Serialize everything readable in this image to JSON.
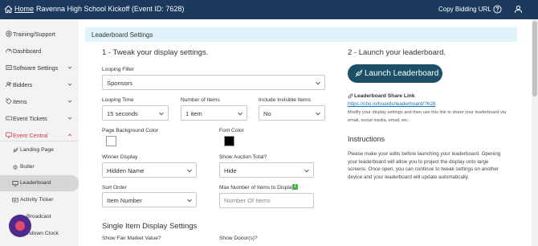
{
  "topbar": {
    "home_label": "Home",
    "event_title": "Ravenna High School Kickoff (Event ID: 7628)",
    "copy_url_label": "Copy Bidding URL"
  },
  "sidebar": {
    "items": [
      {
        "label": "Training/Support",
        "icon": "help-icon"
      },
      {
        "label": "Dashboard",
        "icon": "dashboard-icon"
      },
      {
        "label": "Software Settings",
        "icon": "settings-icon"
      },
      {
        "label": "Bidders",
        "icon": "users-icon"
      },
      {
        "label": "Items",
        "icon": "tag-icon"
      },
      {
        "label": "Event Tickets",
        "icon": "ticket-icon"
      },
      {
        "label": "Event Central",
        "icon": "monitor-icon"
      }
    ],
    "sub_items": [
      {
        "label": "Landing Page",
        "icon": "rocket-icon"
      },
      {
        "label": "Butler",
        "icon": "gear-icon"
      },
      {
        "label": "Leaderboard",
        "icon": "leaderboard-icon"
      },
      {
        "label": "Activity Ticker",
        "icon": "ticker-icon"
      },
      {
        "label": "Broadcast",
        "icon": "broadcast-icon"
      },
      {
        "label": "ndown Clock",
        "icon": "clock-icon"
      }
    ],
    "active_item": "Leaderboard",
    "accent_color": "#d9344a"
  },
  "panel": {
    "title": "Leaderboard Settings",
    "step1_heading": "1 - Tweak your display settings.",
    "step2_heading": "2 - Launch your leaderboard.",
    "looping_filter": {
      "label": "Looping Filter",
      "value": "Sponsors"
    },
    "looping_time": {
      "label": "Looping Time",
      "value": "15 seconds"
    },
    "number_of_items": {
      "label": "Number of Items",
      "value": "1 item"
    },
    "include_invisible": {
      "label": "Include Invisible Items",
      "value": "No"
    },
    "bg_color": {
      "label": "Page Background Color",
      "value": "#ffffff"
    },
    "font_color": {
      "label": "Font Color",
      "value": "#000000"
    },
    "winner_display": {
      "label": "Winner Display",
      "value": "Hidden Name"
    },
    "show_auction_total": {
      "label": "Show Auction Total?",
      "value": "Hide"
    },
    "sort_order": {
      "label": "Sort Order",
      "value": "Item Number"
    },
    "max_items": {
      "label": "Max Number of Items to Display",
      "placeholder": "Number Of Items"
    },
    "single_item_heading": "Single Item Display Settings",
    "show_fmv_label": "Show Fair Market Value?",
    "show_donors_label": "Show Donor(s)?",
    "launch_button": "Launch Leaderboard",
    "share_link_title": "Leaderboard Share Link",
    "share_link_url": "https://cbo.io/boards/leaderboard/?628",
    "share_note_1": "Modify your display settings and then use this link to share your leaderboard via",
    "share_note_2": "email, social media, email, etc.",
    "instructions_heading": "Instructions",
    "instructions_lines": [
      "Please make your edits before launching your leaderboard. Opening",
      "your leaderboard will allow you to project the display onto large",
      "screens. Once open, you can continue to tweak settings on another",
      "device and your leaderboard will update automatically."
    ]
  },
  "colors": {
    "topbar": "#1b3a5c",
    "panel_header": "#dff3fb",
    "launch_button": "#1d4f68",
    "link": "#1a73b5"
  }
}
